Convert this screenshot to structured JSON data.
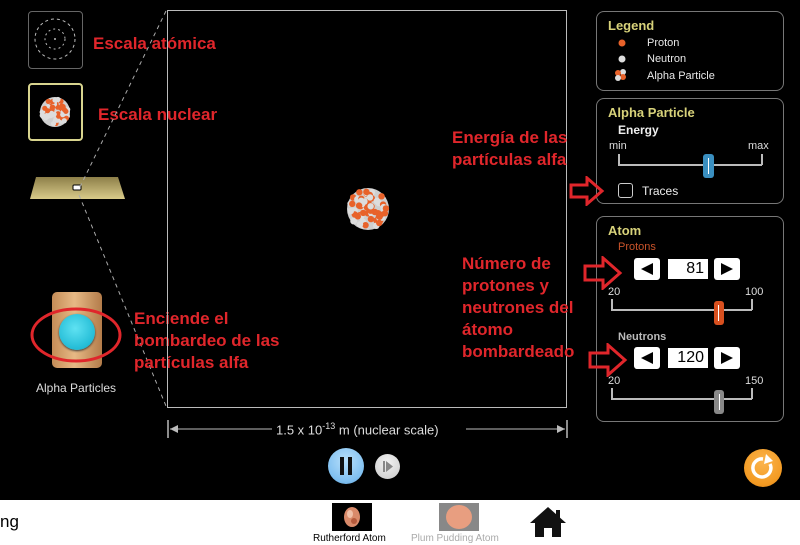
{
  "scale_selector": {
    "atomic_label": "Escala atómica",
    "nuclear_label": "Escala nuclear",
    "selected": "nuclear"
  },
  "gun": {
    "label": "Alpha Particles",
    "annotation": [
      "Enciende el",
      "bombardeo de las",
      "partículas alfa"
    ]
  },
  "view": {
    "scale_text_prefix": "1.5 x 10",
    "scale_text_exp": "-13",
    "scale_text_suffix": " m (nuclear scale)"
  },
  "legend": {
    "title": "Legend",
    "items": [
      {
        "label": "Proton",
        "icon": "proton-icon"
      },
      {
        "label": "Neutron",
        "icon": "neutron-icon"
      },
      {
        "label": "Alpha Particle",
        "icon": "alpha-particle-icon"
      }
    ]
  },
  "alpha_panel": {
    "title": "Alpha Particle",
    "energy_label": "Energy",
    "min_label": "min",
    "max_label": "max",
    "energy_fraction": 0.63,
    "traces_label": "Traces",
    "traces_checked": false,
    "annotation": [
      "Energía de las",
      "partículas alfa"
    ]
  },
  "atom_panel": {
    "title": "Atom",
    "protons": {
      "label": "Protons",
      "value": "81",
      "min": "20",
      "max": "100",
      "numeric": 81,
      "low": 20,
      "high": 100
    },
    "neutrons": {
      "label": "Neutrons",
      "value": "120",
      "min": "20",
      "max": "150",
      "numeric": 120,
      "low": 20,
      "high": 150
    },
    "annotation": [
      "Número de",
      "protones y",
      "neutrones del",
      "átomo",
      "bombardeado"
    ]
  },
  "colors": {
    "proton": "#e8622a",
    "neutron": "#dddddd",
    "panel_title": "#d8d27a",
    "annotation": "#e0262b",
    "reset": "#f39a22",
    "pause": "#8ec9f5"
  },
  "footer": {
    "left_text": "ng",
    "screens": [
      {
        "label": "Rutherford Atom",
        "active": true
      },
      {
        "label": "Plum Pudding Atom",
        "active": false
      }
    ]
  }
}
